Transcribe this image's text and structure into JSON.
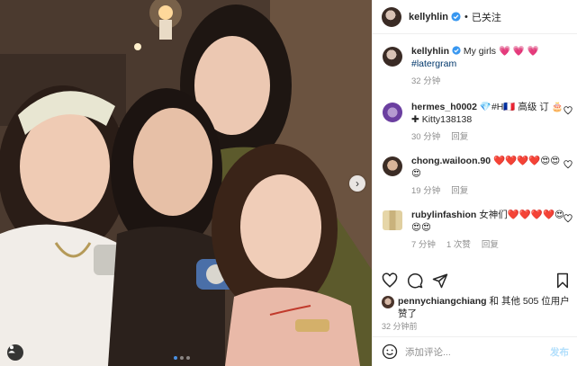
{
  "header": {
    "username": "kellyhlin",
    "separator": "•",
    "follow_status": "已关注"
  },
  "caption": {
    "username": "kellyhlin",
    "text": "My girls 💗 💗 💗",
    "hashtag": "#latergram",
    "time": "32 分钟"
  },
  "comments": [
    {
      "username": "hermes_h0002",
      "text": "💎#H🇫🇷 高级 订 🎂 ✚ Kitty138138",
      "time": "30 分钟",
      "reply": "回复"
    },
    {
      "username": "chong.wailoon.90",
      "text": "❤️❤️❤️❤️😍😍😍",
      "time": "19 分钟",
      "reply": "回复"
    },
    {
      "username": "rubylinfashion",
      "text": "女神们❤️❤️❤️❤️😍😍😍",
      "time": "7 分钟",
      "likes": "1 次赞",
      "reply": "回复"
    }
  ],
  "likes": {
    "username": "pennychiangchiang",
    "text": " 和 其他 505 位用户 赞了"
  },
  "post_time": "32 分钟前",
  "add_comment": {
    "placeholder": "添加评论...",
    "post": "发布"
  },
  "carousel": {
    "count": 3,
    "active_index": 0
  },
  "colors": {
    "verified": "#3897f0",
    "link": "#00376b",
    "meta": "#8e8e8e",
    "post_button": "#b2dffc"
  }
}
